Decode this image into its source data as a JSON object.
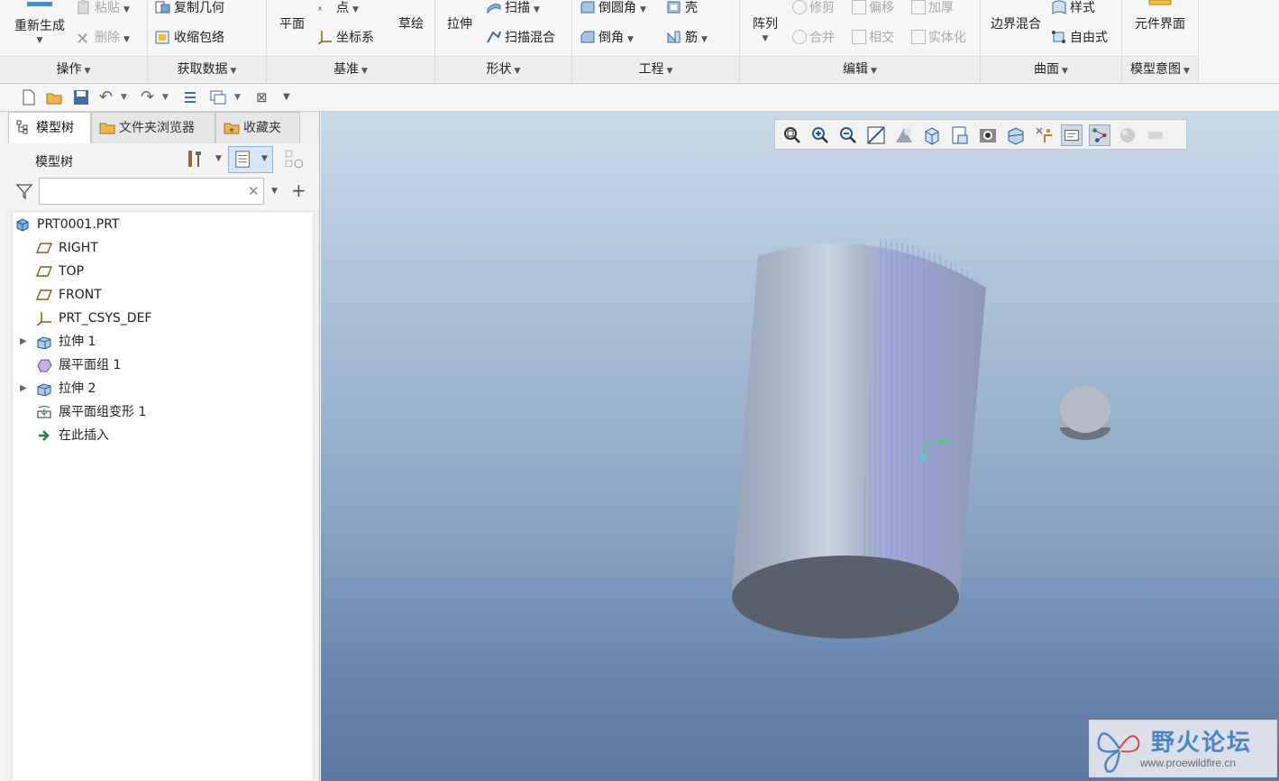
{
  "ribbon": {
    "groups": {
      "operations": "操作",
      "get_data": "获取数据",
      "datum": "基准",
      "shapes": "形状",
      "engineering": "工程",
      "editing": "编辑",
      "surfaces": "曲面",
      "model_intent": "模型意图"
    },
    "regenerate": "重新生成",
    "paste": "粘贴",
    "delete": "删除",
    "copy_geometry": "复制几何",
    "shrinkwrap": "收缩包络",
    "plane": "平面",
    "point": "点",
    "coord_sys": "坐标系",
    "sketch": "草绘",
    "extrude": "拉伸",
    "sweep": "扫描",
    "swept_blend": "扫描混合",
    "round": "倒圆角",
    "chamfer": "倒角",
    "shell": "壳",
    "rib": "筋",
    "pattern": "阵列",
    "trim": "修剪",
    "offset": "偏移",
    "thicken": "加厚",
    "merge": "合并",
    "intersect": "相交",
    "solidify": "实体化",
    "boundary_blend": "边界混合",
    "style": "样式",
    "freestyle": "自由式",
    "component_interface": "元件界面"
  },
  "panel": {
    "tabs": [
      "模型树",
      "文件夹浏览器",
      "收藏夹"
    ],
    "tree_title": "模型树",
    "filter_placeholder": ""
  },
  "tree": {
    "items": [
      {
        "label": "PRT0001.PRT",
        "icon": "part-icon",
        "expandable": false,
        "indent": 0
      },
      {
        "label": "RIGHT",
        "icon": "datum-plane-icon",
        "expandable": false,
        "indent": 1
      },
      {
        "label": "TOP",
        "icon": "datum-plane-icon",
        "expandable": false,
        "indent": 1
      },
      {
        "label": "FRONT",
        "icon": "datum-plane-icon",
        "expandable": false,
        "indent": 1
      },
      {
        "label": "PRT_CSYS_DEF",
        "icon": "csys-icon",
        "expandable": false,
        "indent": 1
      },
      {
        "label": "拉伸 1",
        "icon": "extrude-icon",
        "expandable": true,
        "indent": 1
      },
      {
        "label": "展平面组 1",
        "icon": "flatten-quilt-icon",
        "expandable": false,
        "indent": 1
      },
      {
        "label": "拉伸 2",
        "icon": "extrude-icon",
        "expandable": true,
        "indent": 1
      },
      {
        "label": "展平面组变形 1",
        "icon": "flatten-deform-icon",
        "expandable": false,
        "indent": 1
      },
      {
        "label": "在此插入",
        "icon": "insert-here-icon",
        "expandable": false,
        "indent": 1
      }
    ]
  },
  "watermark": {
    "title": "野火论坛",
    "url": "www.proewildfire.cn"
  },
  "colors": {
    "accent": "#4a86c6",
    "viewport_top": "#c9d9e9",
    "viewport_bottom": "#5b78a2",
    "model_surface": "#a7b4c7"
  }
}
